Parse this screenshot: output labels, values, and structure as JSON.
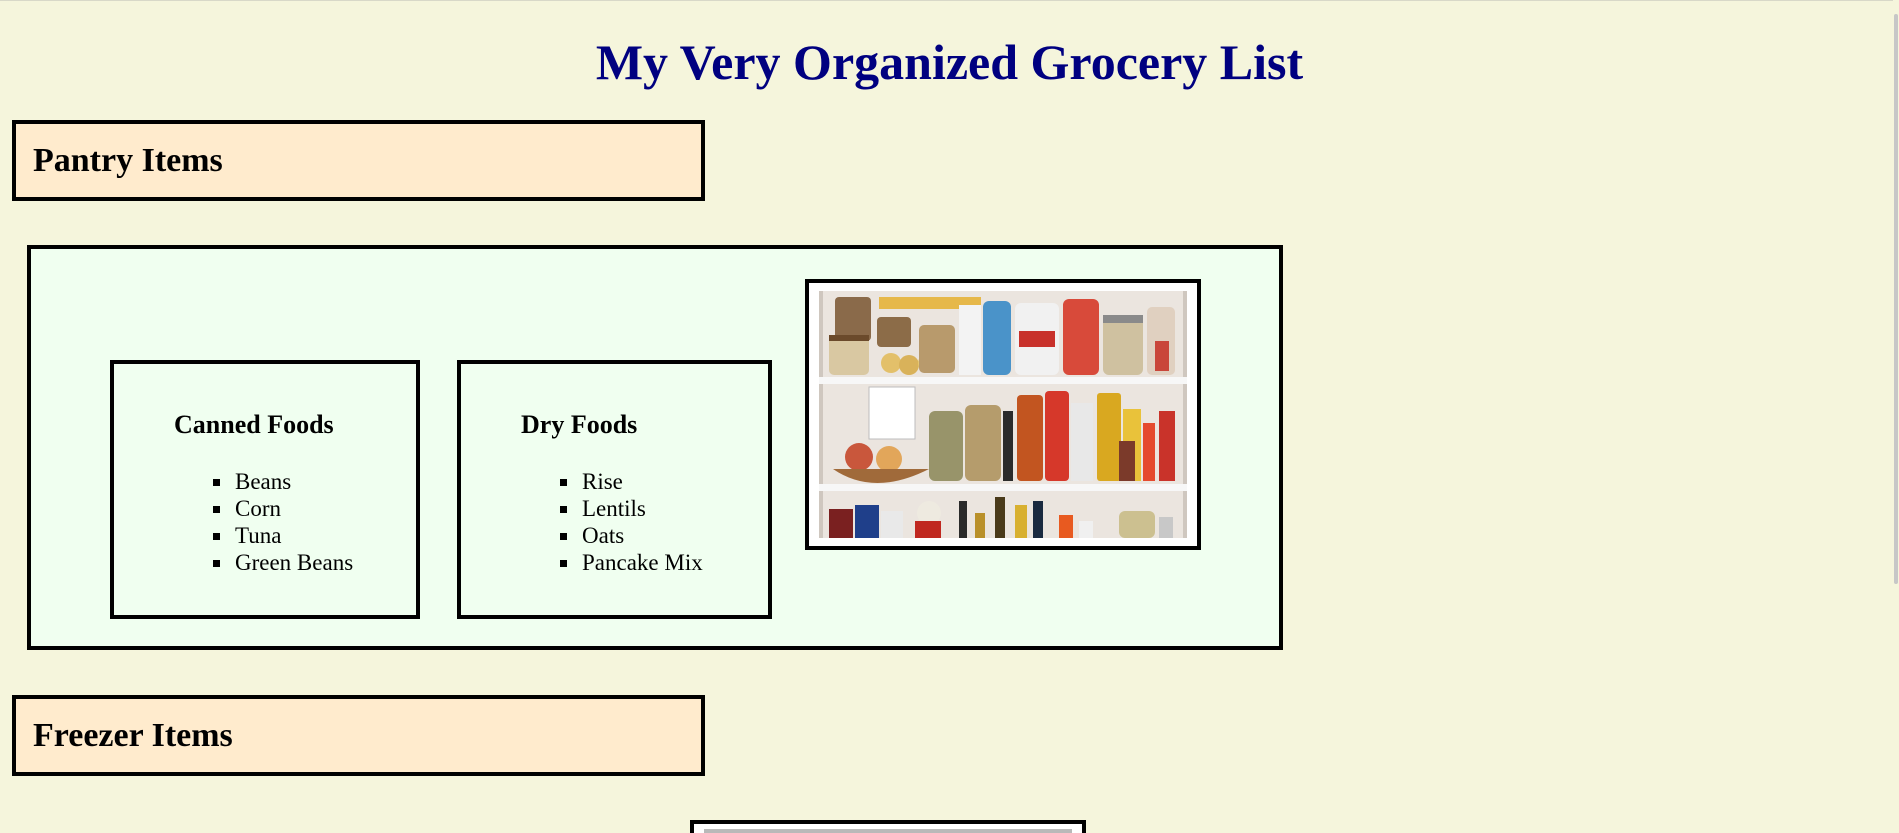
{
  "page": {
    "title": "My Very Organized Grocery List"
  },
  "pantry": {
    "heading": "Pantry Items",
    "categories": [
      {
        "title": "Canned Foods",
        "items": [
          "Beans",
          "Corn",
          "Tuna",
          "Green Beans"
        ]
      },
      {
        "title": "Dry Foods",
        "items": [
          "Rise",
          "Lentils",
          "Oats",
          "Pancake Mix"
        ]
      }
    ],
    "image": {
      "alt": "pantry-shelves-photo"
    }
  },
  "freezer": {
    "heading": "Freezer Items"
  },
  "colors": {
    "background": "#f5f5dc",
    "title": "#000080",
    "section_header_bg": "#ffebcd",
    "pantry_box_bg": "#f0fff0",
    "border": "#000000"
  }
}
